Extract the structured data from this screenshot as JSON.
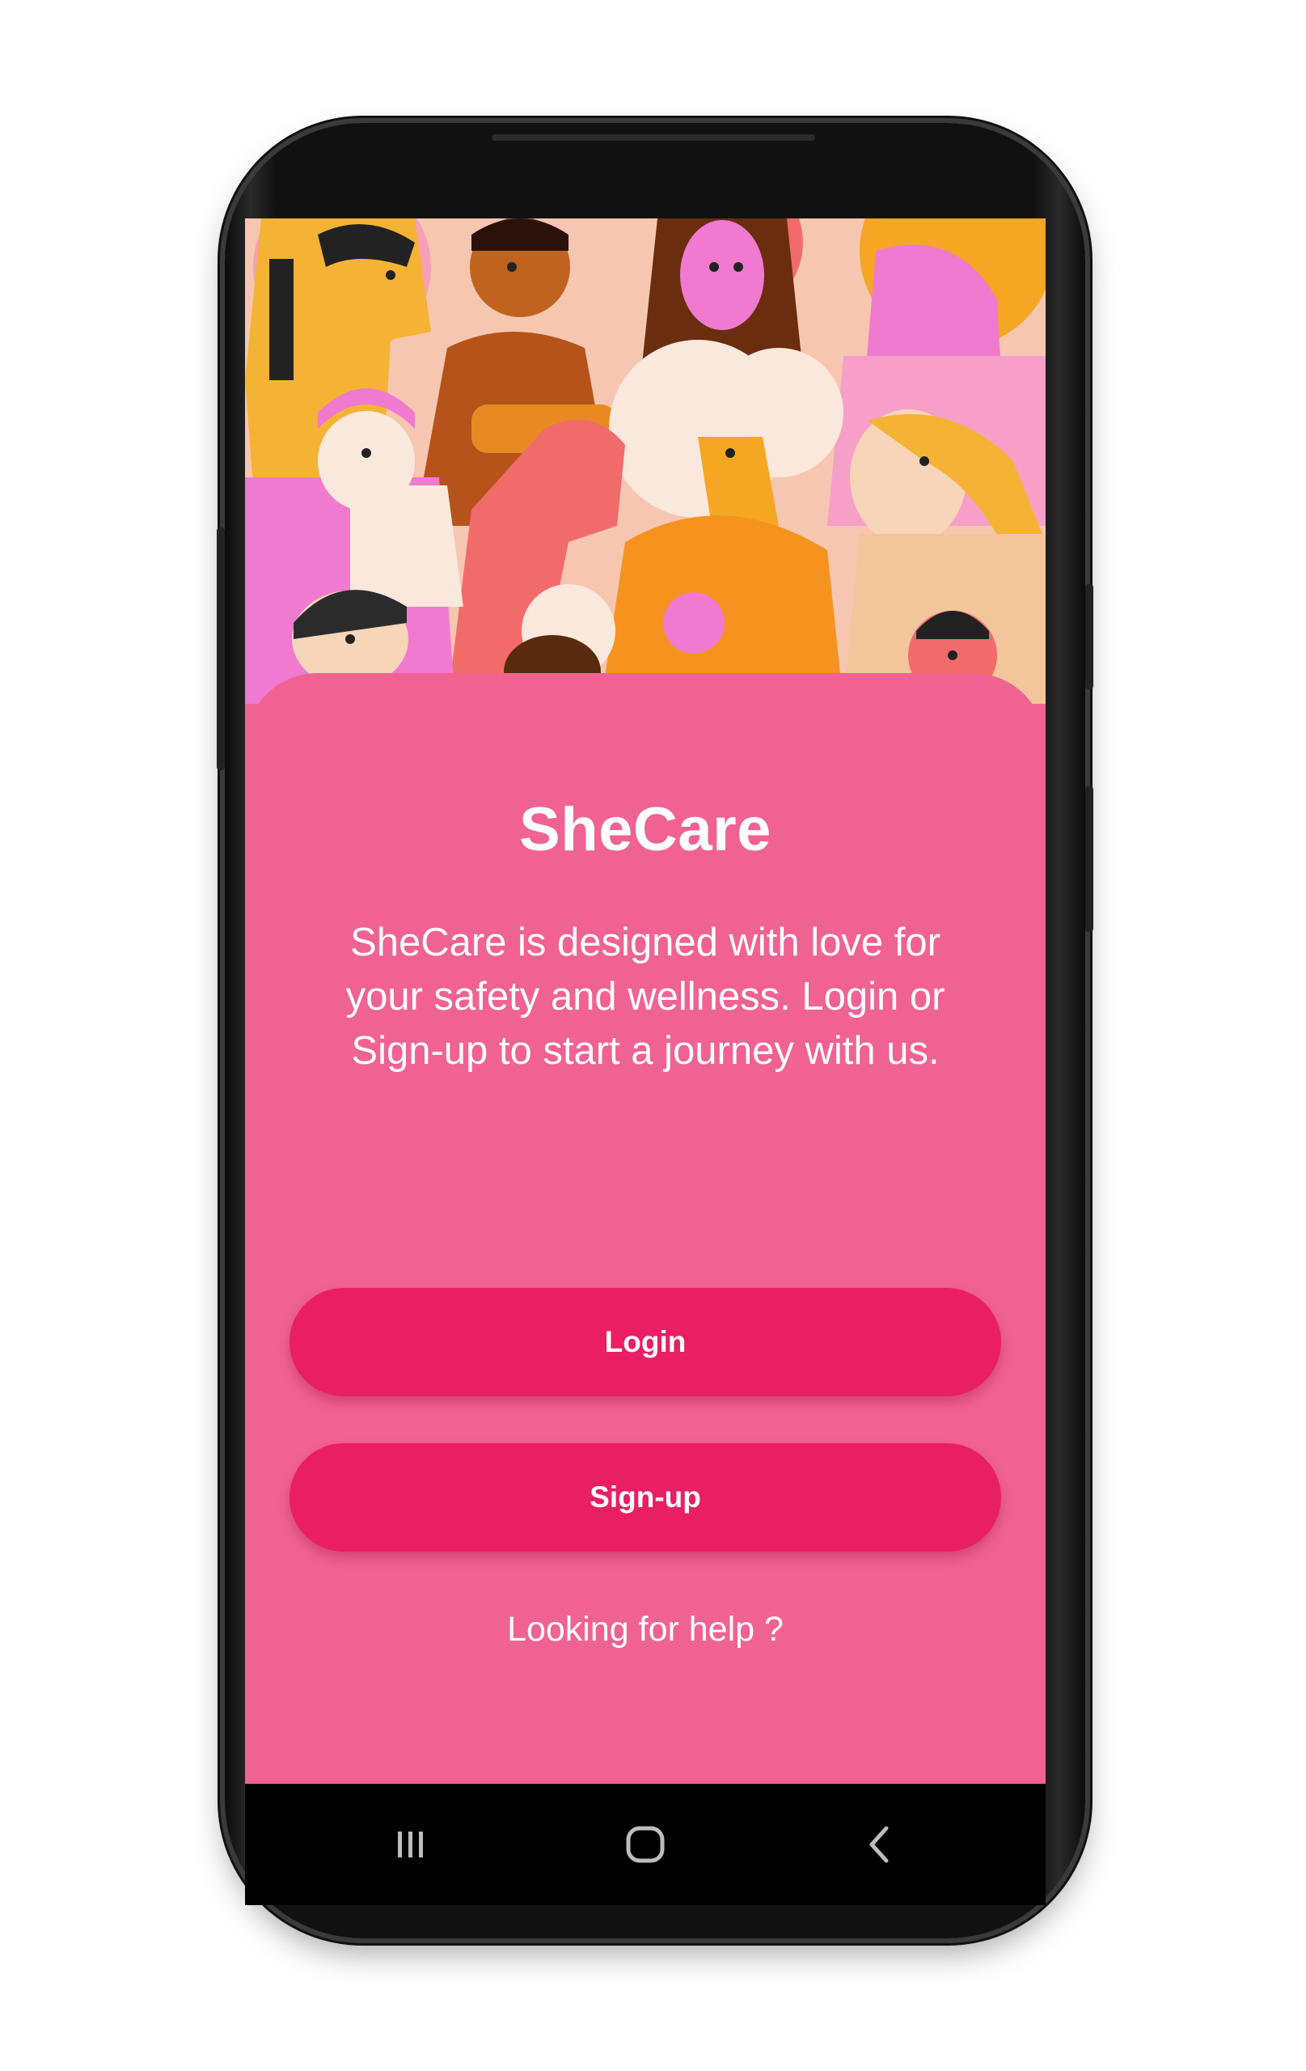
{
  "app": {
    "title": "SheCare",
    "description": "SheCare is designed with love for your safety and wellness. Login or Sign-up to start a journey with us."
  },
  "actions": {
    "login_label": "Login",
    "signup_label": "Sign-up",
    "help_label": "Looking for help ?"
  },
  "colors": {
    "background": "#f06292",
    "button": "#e91e63",
    "text": "#ffffff"
  },
  "illustration": {
    "icon": "women-group-illustration"
  },
  "navigation": {
    "items": [
      "recents-icon",
      "home-icon",
      "back-icon"
    ]
  }
}
